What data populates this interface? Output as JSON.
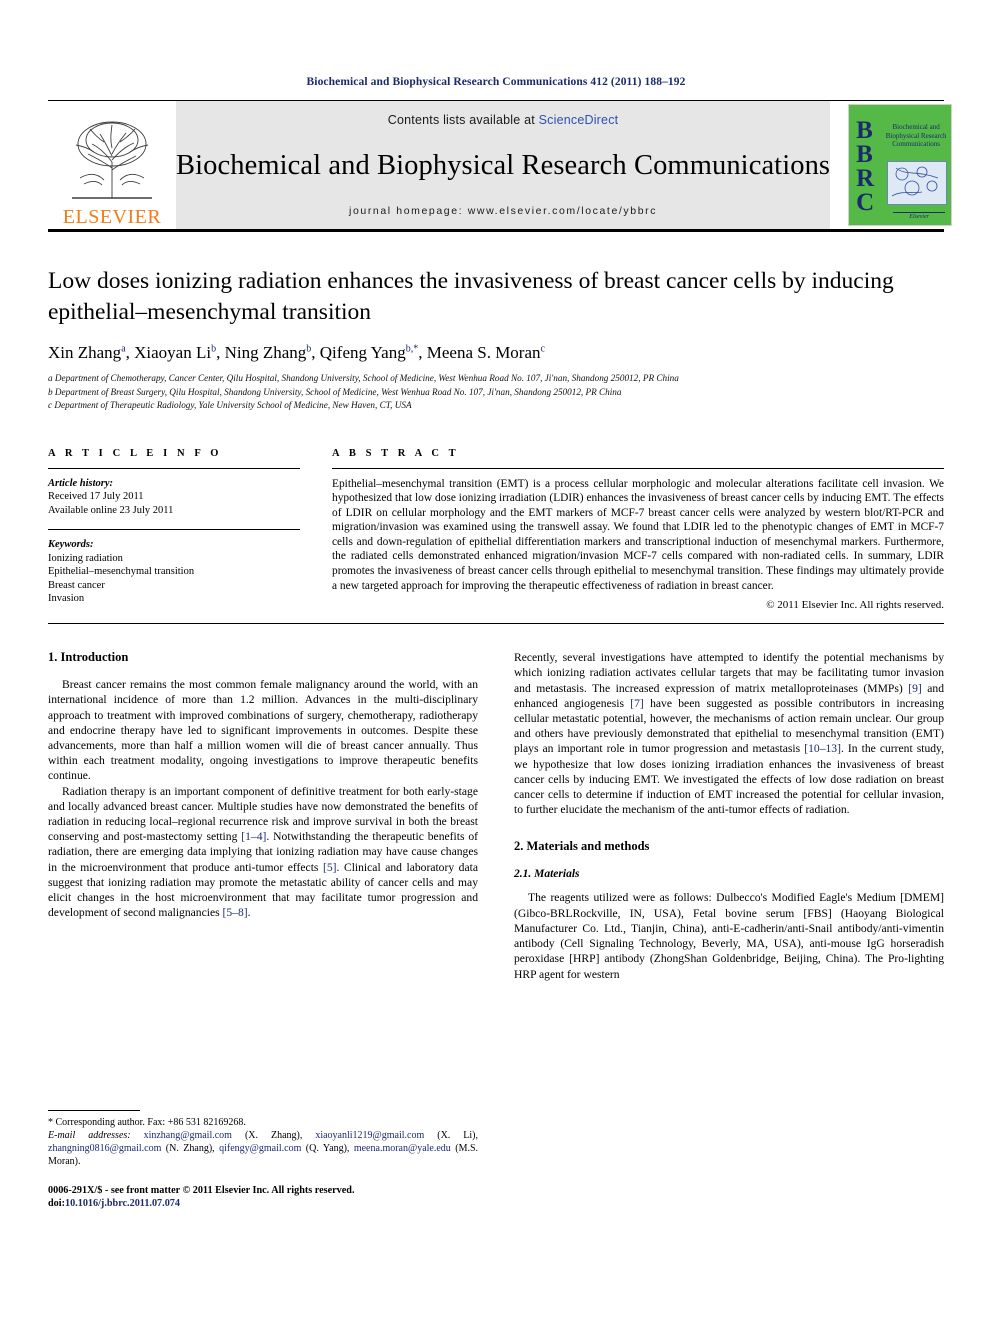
{
  "running_head": "Biochemical and Biophysical Research Communications 412 (2011) 188–192",
  "masthead": {
    "contents_prefix": "Contents lists available at ",
    "sciencedirect": "ScienceDirect",
    "journal_title": "Biochemical and Biophysical Research Communications",
    "homepage": "journal homepage: www.elsevier.com/locate/ybbrc",
    "elsevier_wordmark": "ELSEVIER",
    "cover": {
      "letters": "BBRC",
      "title_lines": "Biochemical and Biophysical Research Communications",
      "publisher": "Elsevier",
      "bg_color": "#55b948",
      "text_color": "#1b2a6b"
    }
  },
  "article": {
    "title": "Low doses ionizing radiation enhances the invasiveness of breast cancer cells by inducing epithelial–mesenchymal transition",
    "authors": "Xin Zhang a, Xiaoyan Li b, Ning Zhang b, Qifeng Yang b*, Meena S. Moran c",
    "affiliations": [
      "a Department of Chemotherapy, Cancer Center, Qilu Hospital, Shandong University, School of Medicine, West Wenhua Road No. 107, Ji'nan, Shandong 250012, PR China",
      "b Department of Breast Surgery, Qilu Hospital, Shandong University, School of Medicine, West Wenhua Road No. 107, Ji'nan, Shandong 250012, PR China",
      "c Department of Therapeutic Radiology, Yale University School of Medicine, New Haven, CT, USA"
    ]
  },
  "article_info": {
    "label": "A R T I C L E   I N F O",
    "history_head": "Article history:",
    "received": "Received 17 July 2011",
    "available": "Available online 23 July 2011",
    "keywords_head": "Keywords:",
    "keywords": [
      "Ionizing radiation",
      "Epithelial–mesenchymal transition",
      "Breast cancer",
      "Invasion"
    ]
  },
  "abstract": {
    "label": "A B S T R A C T",
    "text": "Epithelial–mesenchymal transition (EMT) is a process cellular morphologic and molecular alterations facilitate cell invasion. We hypothesized that low dose ionizing irradiation (LDIR) enhances the invasiveness of breast cancer cells by inducing EMT. The effects of LDIR on cellular morphology and the EMT markers of MCF-7 breast cancer cells were analyzed by western blot/RT-PCR and migration/invasion was examined using the transwell assay. We found that LDIR led to the phenotypic changes of EMT in MCF-7 cells and down-regulation of epithelial differentiation markers and transcriptional induction of mesenchymal markers. Furthermore, the radiated cells demonstrated enhanced migration/invasion MCF-7 cells compared with non-radiated cells. In summary, LDIR promotes the invasiveness of breast cancer cells through epithelial to mesenchymal transition. These findings may ultimately provide a new targeted approach for improving the therapeutic effectiveness of radiation in breast cancer.",
    "copyright": "© 2011 Elsevier Inc. All rights reserved."
  },
  "body": {
    "intro_heading": "1. Introduction",
    "left_paragraphs": [
      "Breast cancer remains the most common female malignancy around the world, with an international incidence of more than 1.2 million. Advances in the multi-disciplinary approach to treatment with improved combinations of surgery, chemotherapy, radiotherapy and endocrine therapy have led to significant improvements in outcomes. Despite these advancements, more than half a million women will die of breast cancer annually. Thus within each treatment modality, ongoing investigations to improve therapeutic benefits continue.",
      "Radiation therapy is an important component of definitive treatment for both early-stage and locally advanced breast cancer. Multiple studies have now demonstrated the benefits of radiation in reducing local–regional recurrence risk and improve survival in both the breast conserving and post-mastectomy setting [1–4]. Notwithstanding the therapeutic benefits of radiation, there are emerging data implying that ionizing radiation may have cause changes in the microenvironment that produce anti-tumor effects [5]. Clinical and laboratory data suggest that ionizing radiation may promote the metastatic ability of cancer cells and may elicit changes in the host microenvironment that may facilitate tumor progression and development of second malignancies [5–8]."
    ],
    "right_paragraph_1": "Recently, several investigations have attempted to identify the potential mechanisms by which ionizing radiation activates cellular targets that may be facilitating tumor invasion and metastasis. The increased expression of matrix metalloproteinases (MMPs) [9] and enhanced angiogenesis [7] have been suggested as possible contributors in increasing cellular metastatic potential, however, the mechanisms of action remain unclear. Our group and others have previously demonstrated that epithelial to mesenchymal transition (EMT) plays an important role in tumor progression and metastasis [10–13]. In the current study, we hypothesize that low doses ionizing irradiation enhances the invasiveness of breast cancer cells by inducing EMT. We investigated the effects of low dose radiation on breast cancer cells to determine if induction of EMT increased the potential for cellular invasion, to further elucidate the mechanism of the anti-tumor effects of radiation.",
    "methods_heading": "2. Materials and methods",
    "materials_heading": "2.1. Materials",
    "materials_paragraph": "The reagents utilized were as follows: Dulbecco's Modified Eagle's Medium [DMEM] (Gibco-BRLRockville, IN, USA), Fetal bovine serum [FBS] (Haoyang Biological Manufacturer Co. Ltd., Tianjin, China), anti-E-cadherin/anti-Snail antibody/anti-vimentin antibody (Cell Signaling Technology, Beverly, MA, USA), anti-mouse IgG horseradish peroxidase [HRP] antibody (ZhongShan Goldenbridge, Beijing, China). The Pro-lighting HRP agent for western"
  },
  "footnotes": {
    "corresponding": "* Corresponding author. Fax: +86 531 82169268.",
    "email_label": "E-mail addresses:",
    "emails": [
      {
        "address": "xinzhang@gmail.com",
        "person": "(X. Zhang)"
      },
      {
        "address": "xiaoyanli1219@gmail.com",
        "person": "(X. Li)"
      },
      {
        "address": "zhangning0816@gmail.com",
        "person": "(N. Zhang)"
      },
      {
        "address": "qifengy@gmail.com",
        "person": "(Q. Yang)"
      },
      {
        "address": "meena.moran@yale.edu",
        "person": "(M.S. Moran)"
      }
    ],
    "issn_line": "0006-291X/$ - see front matter © 2011 Elsevier Inc. All rights reserved.",
    "doi_label": "doi:",
    "doi_value": "10.1016/j.bbrc.2011.07.074"
  },
  "colors": {
    "link_blue": "#1b2a6b",
    "sciencedirect_blue": "#2b50b0",
    "elsevier_orange": "#f07d1a",
    "cover_green": "#55b948"
  }
}
